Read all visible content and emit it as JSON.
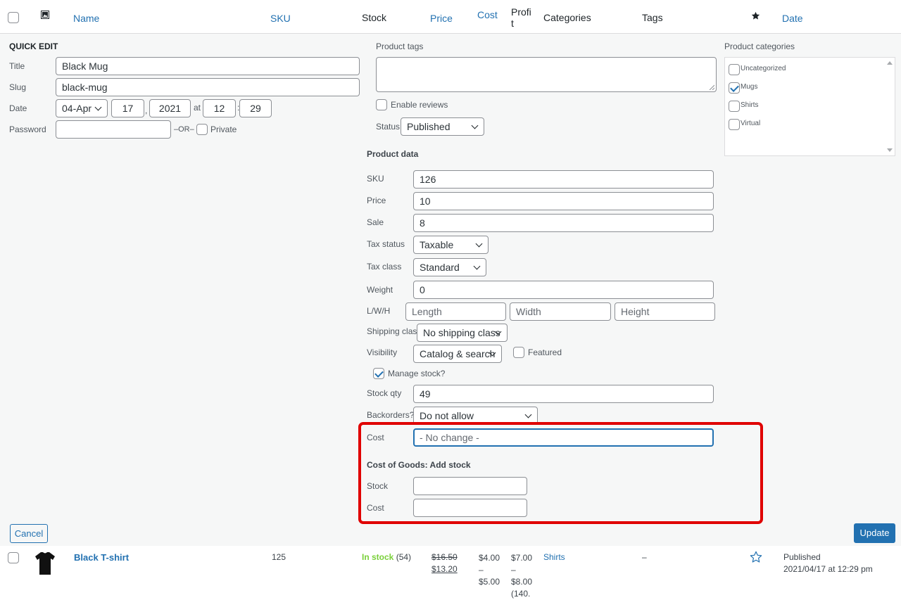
{
  "header": {
    "name": "Name",
    "sku": "SKU",
    "stock": "Stock",
    "price": "Price",
    "cost": "Cost",
    "profit_line1": "Profi",
    "profit_line2": "t",
    "categories": "Categories",
    "tags": "Tags",
    "date": "Date",
    "image_icon": "image-icon",
    "featured_icon": "star-filled-icon"
  },
  "quick_edit": {
    "heading": "QUICK EDIT",
    "title_label": "Title",
    "title_value": "Black Mug",
    "slug_label": "Slug",
    "slug_value": "black-mug",
    "date_label": "Date",
    "month": "04-Apr",
    "day": "17",
    "day_sep": ",",
    "year": "2021",
    "at": "at",
    "hour": "12",
    "time_sep": ":",
    "minute": "29",
    "password_label": "Password",
    "or_text": "–OR–",
    "private_label": "Private",
    "tags_label": "Product tags",
    "enable_reviews": "Enable reviews",
    "status_label": "Status",
    "status_value": "Published",
    "categories_label": "Product categories",
    "categories": [
      {
        "label": "Uncategorized",
        "checked": false
      },
      {
        "label": "Mugs",
        "checked": true
      },
      {
        "label": "Shirts",
        "checked": false
      },
      {
        "label": "Virtual",
        "checked": false
      }
    ]
  },
  "product_data": {
    "heading": "Product data",
    "sku_label": "SKU",
    "sku_value": "126",
    "price_label": "Price",
    "price_value": "10",
    "sale_label": "Sale",
    "sale_value": "8",
    "tax_status_label": "Tax status",
    "tax_status_value": "Taxable",
    "tax_class_label": "Tax class",
    "tax_class_value": "Standard",
    "weight_label": "Weight",
    "weight_value": "0",
    "lwh_label": "L/W/H",
    "length_ph": "Length",
    "width_ph": "Width",
    "height_ph": "Height",
    "shipping_label": "Shipping class",
    "shipping_value": "No shipping class",
    "visibility_label": "Visibility",
    "visibility_value": "Catalog & search",
    "featured_label": "Featured",
    "manage_stock_label": "Manage stock?",
    "stock_qty_label": "Stock qty",
    "stock_qty_value": "49",
    "backorders_label": "Backorders?",
    "backorders_value": "Do not allow",
    "cost_label": "Cost",
    "cost_placeholder": "- No change -",
    "cog_heading": "Cost of Goods: Add stock",
    "cog_stock_label": "Stock",
    "cog_cost_label": "Cost"
  },
  "buttons": {
    "cancel": "Cancel",
    "update": "Update"
  },
  "row": {
    "name": "Black T-shirt",
    "sku": "125",
    "stock_status": "In stock",
    "stock_count": "(54)",
    "price_old": "$16.50",
    "price_new": "$13.20",
    "cost_1": "$4.00",
    "cost_dash": "–",
    "cost_2": "$5.00",
    "profit_1": "$7.00",
    "profit_dash": "–",
    "profit_2": "$8.00",
    "profit_3": "(140.",
    "category": "Shirts",
    "tags": "–",
    "date_status": "Published",
    "date_value": "2021/04/17 at 12:29 pm"
  },
  "colors": {
    "accent": "#2271b1",
    "in_stock": "#7ad03a",
    "highlight": "#e00000"
  }
}
